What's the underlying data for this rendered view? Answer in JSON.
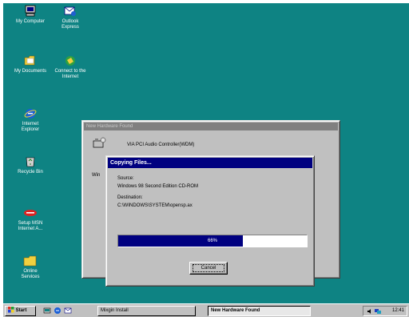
{
  "desktop": {
    "icons": [
      {
        "label": "My Computer"
      },
      {
        "label": "Outlook\nExpress"
      },
      {
        "label": "My Documents"
      },
      {
        "label": "Connect to the\nInternet"
      },
      {
        "label": "Internet\nExplorer"
      },
      {
        "label": "Recycle Bin"
      },
      {
        "label": "Setup MSN\nInternet A..."
      },
      {
        "label": "Online\nServices"
      }
    ]
  },
  "wizard_window": {
    "title": "New Hardware Found",
    "device_name": "VIA PCI Audio Controller(WDM)",
    "status_fragment": "Win"
  },
  "copy_dialog": {
    "title": "Copying Files...",
    "source_label": "Source:",
    "source_value": "Windows 98 Second Edition CD-ROM",
    "destination_label": "Destination:",
    "destination_value": "C:\\WINDOWS\\SYSTEM\\opensp.ax",
    "progress_percent": 66,
    "progress_text": "66%",
    "cancel_label": "Cancel"
  },
  "taskbar": {
    "start_label": "Start",
    "tasks": [
      {
        "label": "Mixgin Install"
      },
      {
        "label": "New Hardware Found"
      }
    ],
    "clock": "12:41"
  }
}
